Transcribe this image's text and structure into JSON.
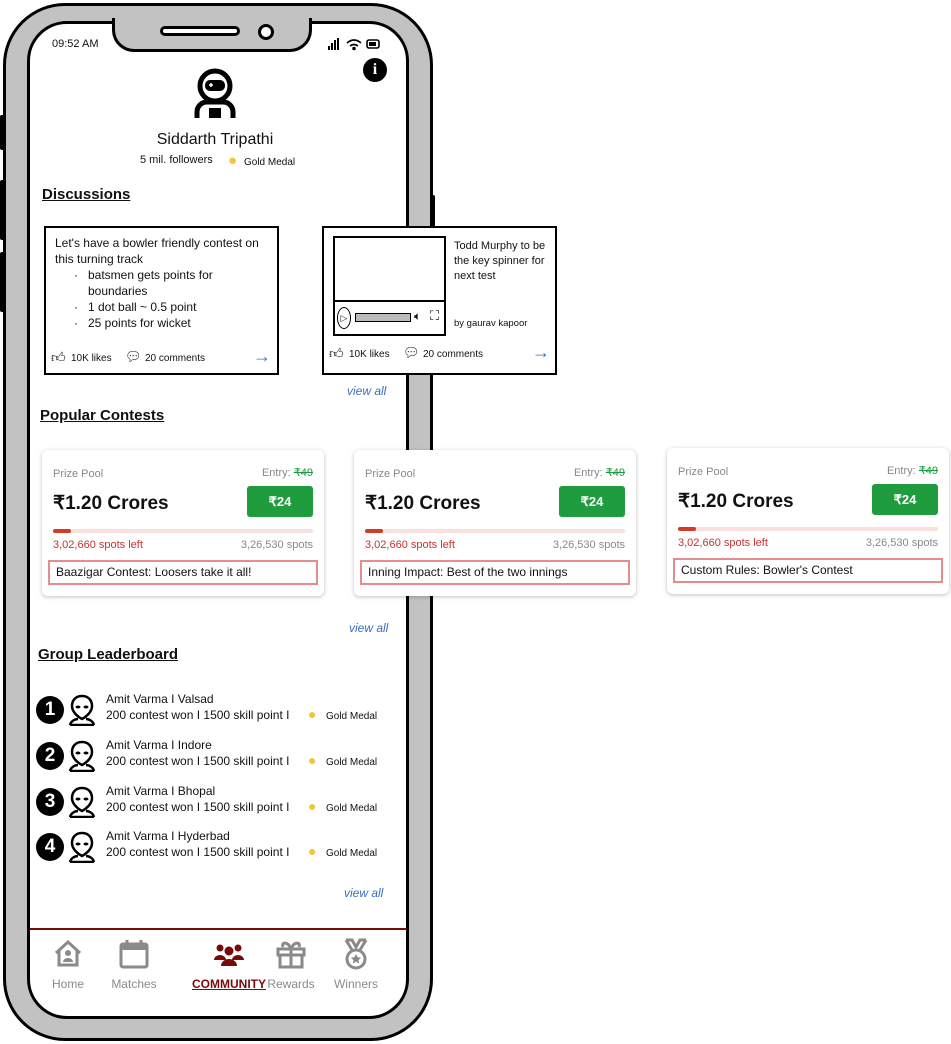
{
  "status_bar": {
    "time": "09:52 AM"
  },
  "profile": {
    "name": "Siddarth Tripathi",
    "followers": "5 mil. followers",
    "medal": "Gold Medal"
  },
  "discussions": {
    "title": "Discussions",
    "post1": {
      "intro": "Let's have a bowler friendly contest on this turning track",
      "bullets": [
        "batsmen gets points for boundaries",
        "1 dot ball ~ 0.5 point",
        "25 points for wicket"
      ],
      "likes": "10K likes",
      "comments": "20 comments"
    },
    "post2": {
      "headline": "Todd Murphy to be the key spinner for next test",
      "author": "by gaurav kapoor",
      "likes": "10K likes",
      "comments": "20 comments"
    },
    "view_all": "view all"
  },
  "contests": {
    "title": "Popular Contests",
    "view_all": "view all",
    "items": [
      {
        "prize_label": "Prize Pool",
        "entry_label": "Entry:",
        "old_price": "₹49",
        "amount": "₹1.20 Crores",
        "price": "₹24",
        "fill_percent": 7,
        "spots_left": "3,02,660 spots left",
        "spots": "3,26,530 spots",
        "name": "Baazigar Contest: Loosers take it all!"
      },
      {
        "prize_label": "Prize Pool",
        "entry_label": "Entry:",
        "old_price": "₹49",
        "amount": "₹1.20 Crores",
        "price": "₹24",
        "fill_percent": 7,
        "spots_left": "3,02,660 spots left",
        "spots": "3,26,530 spots",
        "name": "Inning Impact: Best of the two innings"
      },
      {
        "prize_label": "Prize Pool",
        "entry_label": "Entry:",
        "old_price": "₹49",
        "amount": "₹1.20 Crores",
        "price": "₹24",
        "fill_percent": 7,
        "spots_left": "3,02,660 spots left",
        "spots": "3,26,530 spots",
        "name": "Custom Rules: Bowler's Contest"
      }
    ]
  },
  "leaderboard": {
    "title": "Group Leaderboard",
    "view_all": "view all",
    "items": [
      {
        "rank": "1",
        "name": "Amit Varma I Valsad",
        "stats": "200 contest won I 1500 skill point I",
        "medal": "Gold Medal"
      },
      {
        "rank": "2",
        "name": "Amit Varma I Indore",
        "stats": "200 contest won I 1500 skill point I",
        "medal": "Gold Medal"
      },
      {
        "rank": "3",
        "name": "Amit Varma I Bhopal",
        "stats": "200 contest won I 1500 skill point I",
        "medal": "Gold Medal"
      },
      {
        "rank": "4",
        "name": "Amit Varma I Hyderbad",
        "stats": "200 contest won I 1500 skill point I",
        "medal": "Gold Medal"
      }
    ]
  },
  "nav": {
    "items": [
      {
        "label": "Home",
        "icon": "home-icon"
      },
      {
        "label": "Matches",
        "icon": "calendar-icon"
      },
      {
        "label": "COMMUNITY",
        "icon": "community-icon",
        "active": true
      },
      {
        "label": "Rewards",
        "icon": "gift-icon"
      },
      {
        "label": "Winners",
        "icon": "medal-icon"
      }
    ]
  },
  "colors": {
    "accent": "#7a0a0a",
    "green": "#1f9d3e",
    "red": "#c73232",
    "link": "#3a6fc0",
    "gold": "#f2c53d"
  }
}
